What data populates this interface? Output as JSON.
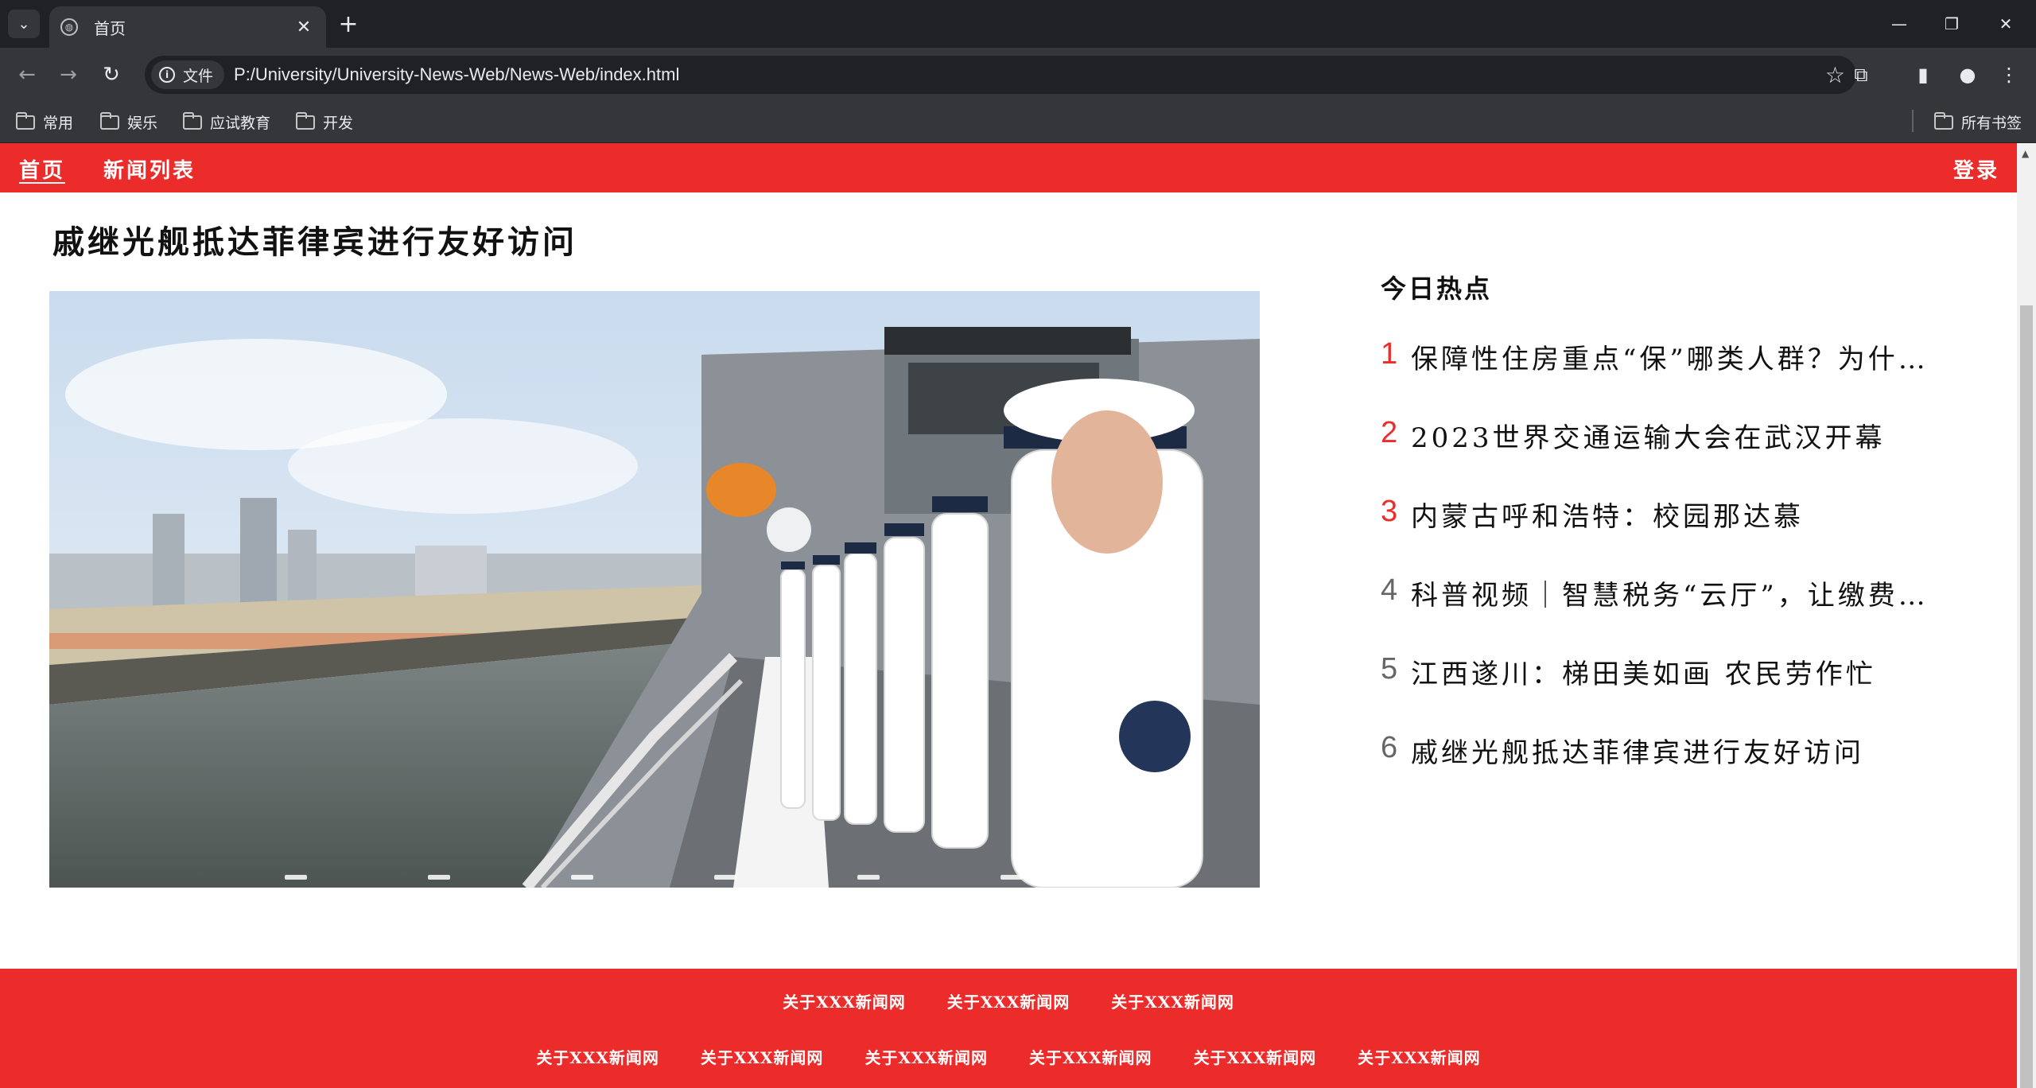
{
  "browser": {
    "tab_title": "首页",
    "site_chip": "文件",
    "url": "P:/University/University-News-Web/News-Web/index.html",
    "bookmarks": [
      "常用",
      "娱乐",
      "应试教育",
      "开发"
    ],
    "all_bookmarks": "所有书签"
  },
  "nav": {
    "home": "首页",
    "news_list": "新闻列表",
    "login": "登录"
  },
  "main": {
    "headline": "戚继光舰抵达菲律宾进行友好访问",
    "carousel_slide_count": 6
  },
  "hot": {
    "title": "今日热点",
    "items": [
      {
        "num": "1",
        "text": "保障性住房重点“保”哪类人群？为什么要推进保障性住房建设"
      },
      {
        "num": "2",
        "text": "2023世界交通运输大会在武汉开幕"
      },
      {
        "num": "3",
        "text": "内蒙古呼和浩特：校园那达慕"
      },
      {
        "num": "4",
        "text": "科普视频｜智慧税务“云厅”，让缴费人办税更便捷"
      },
      {
        "num": "5",
        "text": "江西遂川：梯田美如画 农民劳作忙"
      },
      {
        "num": "6",
        "text": "戚继光舰抵达菲律宾进行友好访问"
      }
    ]
  },
  "footer": {
    "row1": [
      "关于XXX新闻网",
      "关于XXX新闻网",
      "关于XXX新闻网"
    ],
    "row2": [
      "关于XXX新闻网",
      "关于XXX新闻网",
      "关于XXX新闻网",
      "关于XXX新闻网",
      "关于XXX新闻网",
      "关于XXX新闻网"
    ]
  },
  "colors": {
    "brand_red": "#ec2b2b",
    "chrome_dark": "#202124",
    "chrome_mid": "#35363a"
  },
  "icons": [
    "chevron-down-icon",
    "globe-icon",
    "close-icon",
    "plus-icon",
    "minimize-icon",
    "restore-icon",
    "window-close-icon",
    "back-icon",
    "forward-icon",
    "reload-icon",
    "info-icon",
    "star-icon",
    "extensions-icon",
    "sidepanel-icon",
    "profile-icon",
    "more-icon",
    "folder-icon"
  ]
}
